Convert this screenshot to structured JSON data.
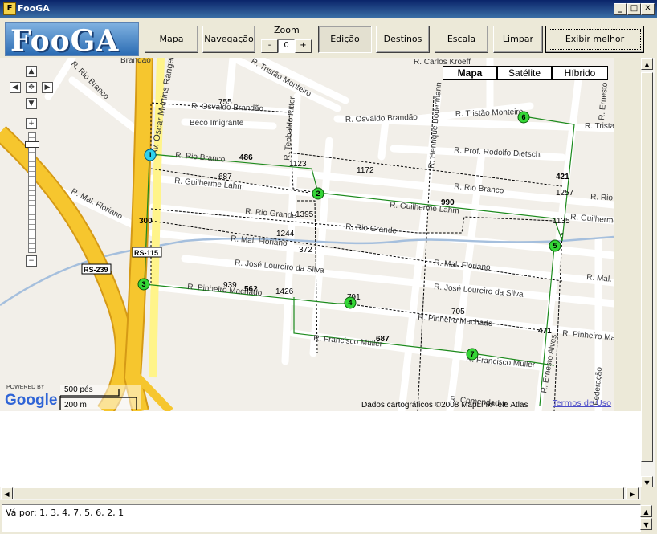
{
  "window": {
    "title": "FooGA",
    "icon": "app-logo-icon",
    "controls": {
      "minimize": "_",
      "maximize": "□",
      "close": "✕"
    }
  },
  "toolbar": {
    "logo_text": "FooGA",
    "buttons": {
      "mapa": "Mapa",
      "navegacao": "Navegação",
      "edicao": "Edição",
      "destinos": "Destinos",
      "escala": "Escala",
      "limpar": "Limpar",
      "exibir": "Exibir melhor caminho!"
    },
    "zoom": {
      "label": "Zoom",
      "minus": "-",
      "value": "0",
      "plus": "+"
    }
  },
  "map": {
    "type_buttons": [
      "Mapa",
      "Satélite",
      "Híbrido"
    ],
    "selected_type": "Mapa",
    "powered_by": "POWERED BY",
    "google": "Google",
    "scale": [
      "500 pés",
      "200 m"
    ],
    "copyright": "Dados cartográficos ©2008 MapLink/Tele Atlas",
    "terms": "Termos de Uso",
    "streets": {
      "oscar": "Av. Oscar Martins Rangel",
      "rio_branco_1": "R. Rio Branco",
      "rio_branco_2": "R. Rio Branco",
      "rio_branco_3": "R. Rio Branco",
      "rio_branco_4": "R. Rio Branco",
      "tristao_monteiro_1": "R. Tristão Monteiro",
      "tristao_monteiro_2": "R. Tristão Monteiro",
      "osvaldo_1": "R. Osvaldo Brandão",
      "osvaldo_2": "R. Osvaldo Brandão",
      "brandao": "Brandão",
      "beco": "Beco Imigrante",
      "teobaldo": "R. Teobaldo Ritter",
      "guilherme_1": "R. Guilherme Lahm",
      "guilherme_2": "R. Guilherme Lahm",
      "guilherme_3": "R. Guilherme",
      "rio_grande_1": "R. Rio Grande",
      "rio_grande_2": "R. Rio Grande",
      "floriano_1": "R. Mal. Floriano",
      "floriano_2": "R. Mal. Floriano",
      "floriano_3": "R. Mal. Floriano",
      "floriano_4": "R. Mal. Fl",
      "jose_1": "R. José Loureiro da Silva",
      "jose_2": "R. José Loureiro da Silva",
      "pinheiro_1": "R. Pinheiro Machado",
      "pinheiro_2": "R. Pinheiro Machado",
      "pinheiro_3": "R. Pinheiro Ma",
      "francisco_1": "R. Francisco Müller",
      "francisco_2": "R. Francisco Müller",
      "dietschi": "R. Prof. Rodolfo Dietschi",
      "carlos": "R. Carlos Kroeff",
      "henrique": "R. Henrique Bodermann",
      "ernesto_1": "R. Ernesto Alves",
      "ernesto_2": "R. Ernesto",
      "tristao_short": "R. Trista",
      "federacao": "Federação",
      "comendador": "R. Comendador"
    },
    "shields": [
      "RS-115",
      "RS-239"
    ],
    "waypoints": [
      "1",
      "2",
      "3",
      "4",
      "5",
      "6",
      "7"
    ],
    "route_numbers": {
      "n755": "755",
      "n486": "486",
      "n687a": "687",
      "n1123": "1123",
      "n1172": "1172",
      "n421": "421",
      "n1257": "1257",
      "n990": "990",
      "n1135": "1135",
      "n1395": "1395",
      "n300": "300",
      "n1244": "1244",
      "n372": "372",
      "n939": "939",
      "n562": "562",
      "n1426": "1426",
      "n791": "791",
      "n705": "705",
      "n471": "471",
      "n687b": "687"
    },
    "colors": {
      "road": "#ffffff",
      "highway": "#f6c62e",
      "main_road": "#fff48a",
      "route_green": "#1c8a1c",
      "marker_green": "#35d637",
      "marker_blue": "#2fd2ef",
      "water": "#a5bfdd"
    }
  },
  "status": {
    "text": "Vá por: 1, 3, 4, 7, 5, 6, 2, 1"
  }
}
